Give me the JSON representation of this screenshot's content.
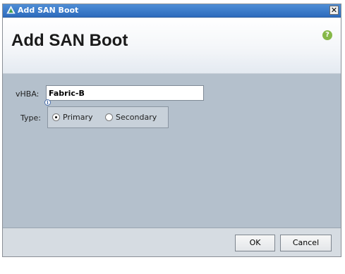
{
  "window": {
    "title": "Add SAN Boot",
    "close_glyph": "✕",
    "icon": "app-logo-icon"
  },
  "header": {
    "title": "Add SAN Boot",
    "help_glyph": "?",
    "help_icon": "help-icon"
  },
  "form": {
    "vhba_label": "vHBA:",
    "vhba_value": "Fabric-B",
    "info_glyph": "i",
    "type_label": "Type:",
    "type_options": [
      {
        "label": "Primary",
        "selected": true
      },
      {
        "label": "Secondary",
        "selected": false
      }
    ]
  },
  "footer": {
    "ok_label": "OK",
    "cancel_label": "Cancel"
  },
  "colors": {
    "titlebar": "#3a7bd0",
    "content_bg": "#b4c0cc",
    "help_green": "#86b848"
  }
}
